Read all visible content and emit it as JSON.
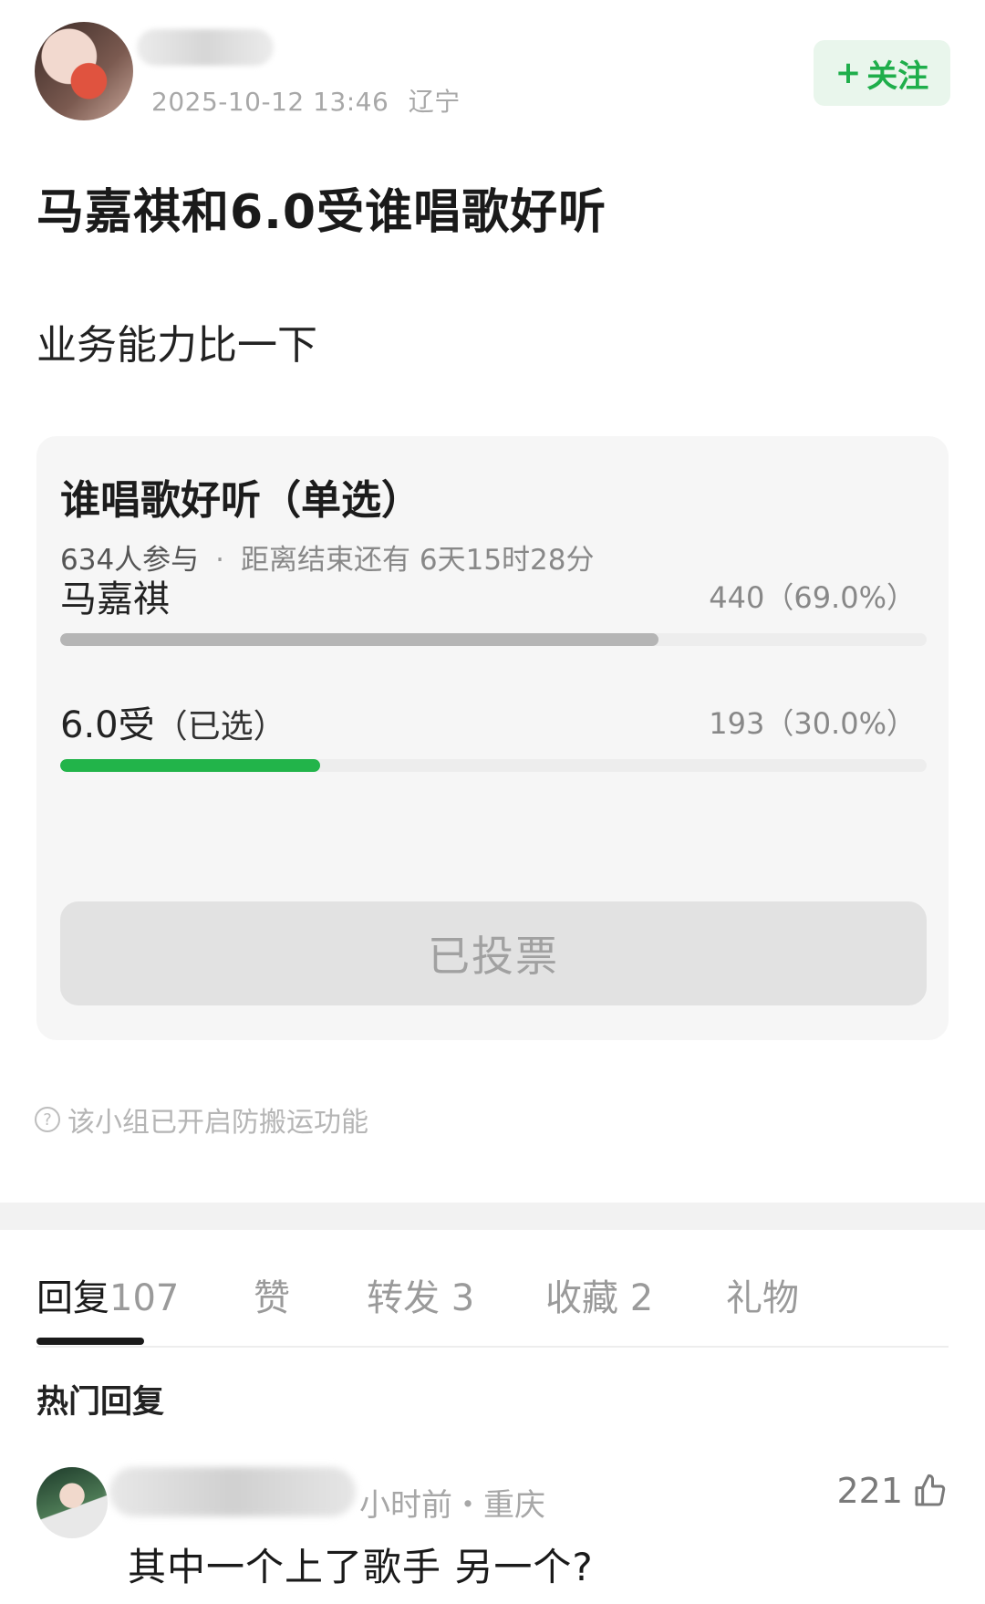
{
  "post": {
    "timestamp": "2025-10-12 13:46",
    "location": "辽宁",
    "follow_label": "关注",
    "title": "马嘉祺和6.0受谁唱歌好听",
    "body": "业务能力比一下"
  },
  "poll": {
    "title": "谁唱歌好听（单选）",
    "participants": "634人参与",
    "remaining": "距离结束还有 6天15时28分",
    "options": [
      {
        "name": "马嘉祺",
        "picked": "",
        "count": "440（69.0%）",
        "fraction": 0.69,
        "color": "#b5b5b5"
      },
      {
        "name": "6.0受",
        "picked": "（已选）",
        "count": "193（30.0%）",
        "fraction": 0.3,
        "color": "#22b44a"
      }
    ],
    "vote_button_label": "已投票"
  },
  "notice": "该小组已开启防搬运功能",
  "tabs": [
    {
      "label": "回复",
      "count": "107"
    },
    {
      "label": "赞",
      "count": ""
    },
    {
      "label": "转发",
      "count": "3"
    },
    {
      "label": "收藏",
      "count": "2"
    },
    {
      "label": "礼物",
      "count": ""
    }
  ],
  "hot_replies_label": "热门回复",
  "comment": {
    "meta": "小时前・重庆",
    "likes": "221",
    "text": "其中一个上了歌手 另一个?"
  },
  "colors": {
    "accent_green": "#1fae4b",
    "follow_bg": "#e9f6ec"
  }
}
